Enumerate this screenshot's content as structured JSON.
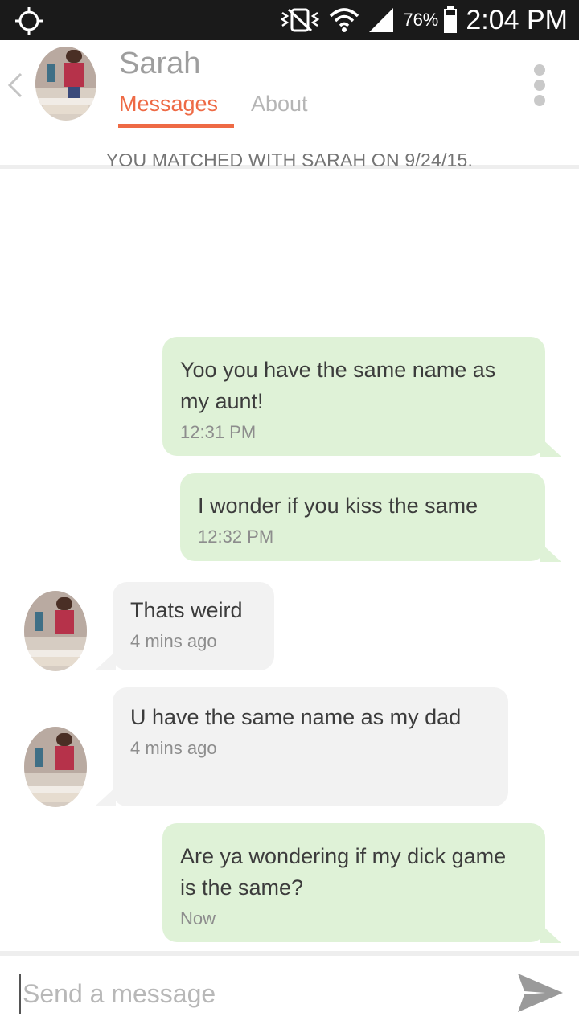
{
  "status_bar": {
    "battery_percent": "76%",
    "time": "2:04 PM",
    "icons": [
      "gps-target-icon",
      "vibrate-icon",
      "wifi-icon",
      "signal-icon",
      "battery-icon"
    ]
  },
  "header": {
    "name": "Sarah",
    "tabs": [
      {
        "label": "Messages",
        "active": true
      },
      {
        "label": "About",
        "active": false
      }
    ],
    "accent_color": "#ee6a45"
  },
  "match_note": "YOU MATCHED WITH SARAH ON 9/24/15.",
  "messages": [
    {
      "from": "me",
      "text": "Yoo you have the same name as my aunt!",
      "time": "12:31 PM"
    },
    {
      "from": "me",
      "text": "I wonder if you kiss the same",
      "time": "12:32 PM"
    },
    {
      "from": "them",
      "text": "Thats weird",
      "time": "4 mins ago"
    },
    {
      "from": "them",
      "text": "U have the same name as my dad",
      "time": "4 mins ago"
    },
    {
      "from": "me",
      "text": "Are ya wondering if my dick game is the same?",
      "time": "Now"
    }
  ],
  "composer": {
    "placeholder": "Send a message"
  },
  "colors": {
    "my_bubble": "#dff2d7",
    "their_bubble": "#f2f2f2"
  }
}
